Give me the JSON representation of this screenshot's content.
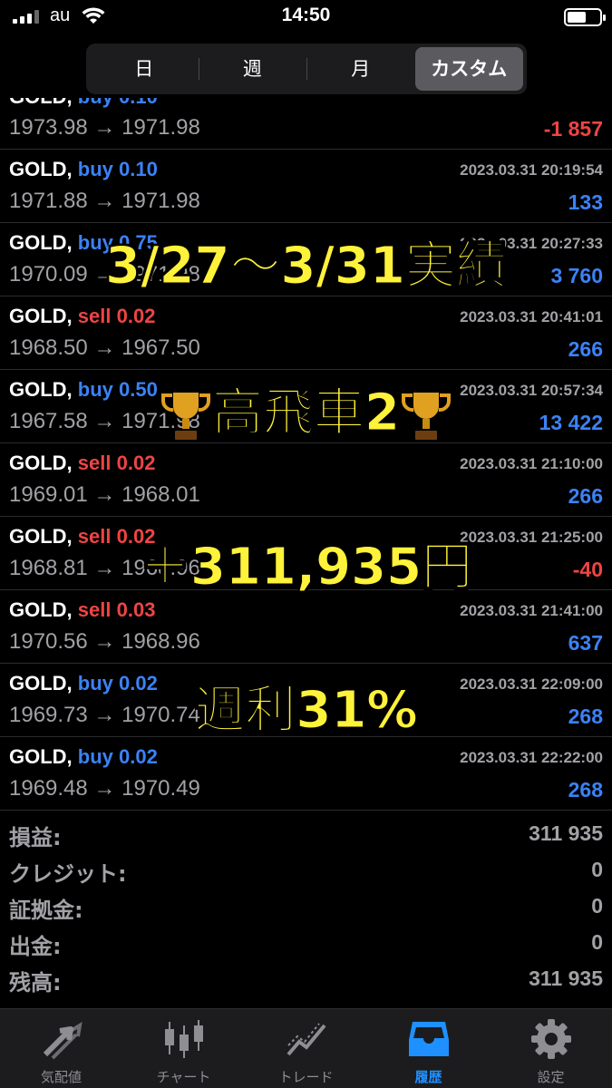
{
  "status": {
    "carrier": "au",
    "time": "14:50"
  },
  "segments": [
    "日",
    "週",
    "月",
    "カスタム"
  ],
  "trades": [
    {
      "symbol": "GOLD,",
      "side": "buy",
      "volume": "0.10",
      "date": "",
      "prices": "1973.98 → 1971.98",
      "profit": "-1 857",
      "sign": "neg"
    },
    {
      "symbol": "GOLD,",
      "side": "buy",
      "volume": "0.10",
      "date": "2023.03.31 20:19:54",
      "prices": "1971.88 → 1971.98",
      "profit": "133",
      "sign": "pos"
    },
    {
      "symbol": "GOLD,",
      "side": "buy",
      "volume": "0.75",
      "date": "2023.03.31 20:27:33",
      "prices": "1970.09 → 1971.98",
      "profit": "3 760",
      "sign": "pos"
    },
    {
      "symbol": "GOLD,",
      "side": "sell",
      "volume": "0.02",
      "date": "2023.03.31 20:41:01",
      "prices": "1968.50 → 1967.50",
      "profit": "266",
      "sign": "pos"
    },
    {
      "symbol": "GOLD,",
      "side": "buy",
      "volume": "0.50",
      "date": "2023.03.31 20:57:34",
      "prices": "1967.58 → 1971.98",
      "profit": "13 422",
      "sign": "pos"
    },
    {
      "symbol": "GOLD,",
      "side": "sell",
      "volume": "0.02",
      "date": "2023.03.31 21:10:00",
      "prices": "1969.01 → 1968.01",
      "profit": "266",
      "sign": "pos"
    },
    {
      "symbol": "GOLD,",
      "side": "sell",
      "volume": "0.02",
      "date": "2023.03.31 21:25:00",
      "prices": "1968.81 → 1968.96",
      "profit": "-40",
      "sign": "neg"
    },
    {
      "symbol": "GOLD,",
      "side": "sell",
      "volume": "0.03",
      "date": "2023.03.31 21:41:00",
      "prices": "1970.56 → 1968.96",
      "profit": "637",
      "sign": "pos"
    },
    {
      "symbol": "GOLD,",
      "side": "buy",
      "volume": "0.02",
      "date": "2023.03.31 22:09:00",
      "prices": "1969.73 → 1970.74",
      "profit": "268",
      "sign": "pos"
    },
    {
      "symbol": "GOLD,",
      "side": "buy",
      "volume": "0.02",
      "date": "2023.03.31 22:22:00",
      "prices": "1969.48 → 1970.49",
      "profit": "268",
      "sign": "pos"
    }
  ],
  "summary": [
    {
      "label": "損益:",
      "value": "311 935"
    },
    {
      "label": "クレジット:",
      "value": "0"
    },
    {
      "label": "証拠金:",
      "value": "0"
    },
    {
      "label": "出金:",
      "value": "0"
    },
    {
      "label": "残高:",
      "value": "311 935"
    }
  ],
  "overlay": {
    "line1": "3/27〜3/31実績",
    "line2": "高飛車2",
    "line3": "＋311,935円",
    "line4": "週利31%"
  },
  "tabs": [
    "気配値",
    "チャート",
    "トレード",
    "履歴",
    "設定"
  ],
  "colors": {
    "buy": "#3b82f6",
    "sell": "#ef4444",
    "accent": "#1e90ff",
    "overlay": "#fff23a"
  }
}
